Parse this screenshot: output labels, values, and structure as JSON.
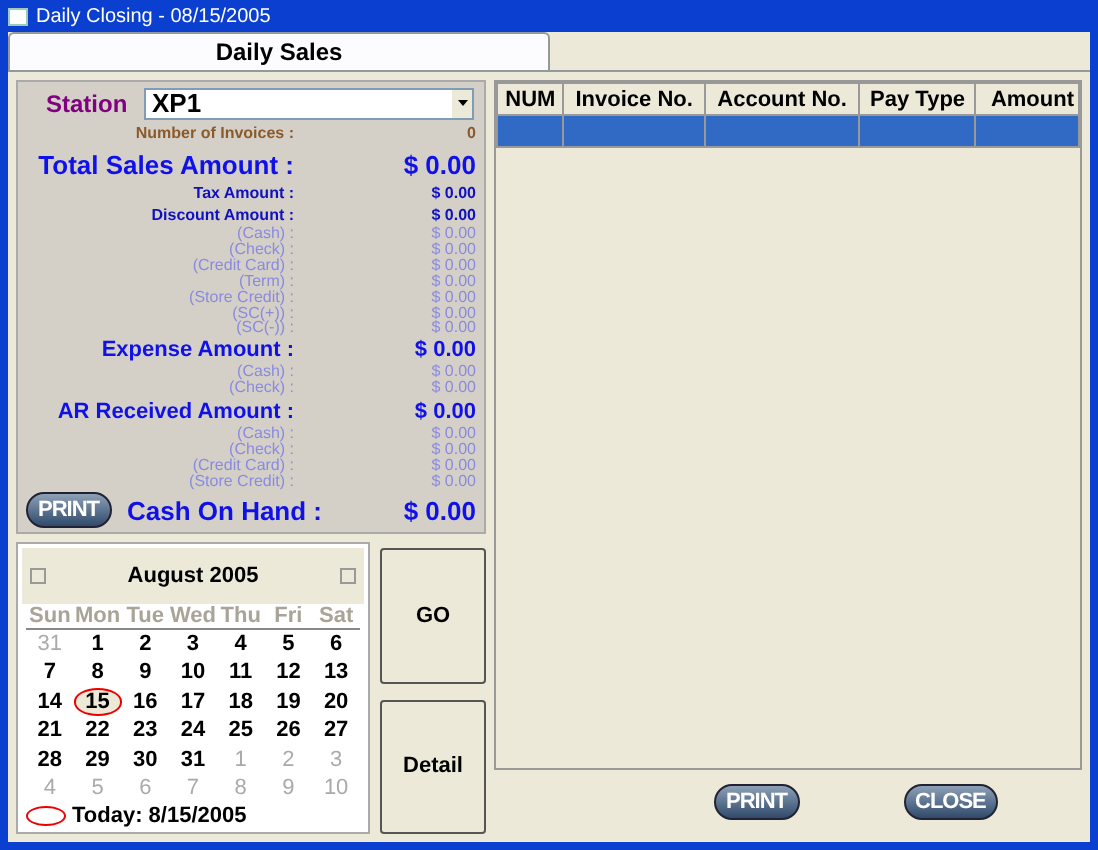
{
  "window": {
    "title": "Daily Closing - 08/15/2005"
  },
  "tabs": [
    {
      "label": "Daily Sales",
      "selected": true
    }
  ],
  "station": {
    "label": "Station",
    "value": "XP1"
  },
  "summary": [
    {
      "kind": "count",
      "label": "Number of Invoices :",
      "value": "0"
    },
    {
      "kind": "major",
      "label": "Total Sales Amount :",
      "value": "$ 0.00"
    },
    {
      "kind": "medium",
      "label": "Tax Amount :",
      "value": "$ 0.00"
    },
    {
      "kind": "medium",
      "label": "Discount Amount :",
      "value": "$ 0.00"
    },
    {
      "kind": "minor",
      "label": "(Cash) :",
      "value": "$ 0.00"
    },
    {
      "kind": "minor",
      "label": "(Check) :",
      "value": "$ 0.00"
    },
    {
      "kind": "minor",
      "label": "(Credit Card) :",
      "value": "$ 0.00"
    },
    {
      "kind": "minor",
      "label": "(Term) :",
      "value": "$ 0.00"
    },
    {
      "kind": "minor",
      "label": "(Store Credit) :",
      "value": "$ 0.00"
    },
    {
      "kind": "tight",
      "label": "(SC(+)) :",
      "value": "$ 0.00"
    },
    {
      "kind": "tight",
      "label": "(SC(-)) :",
      "value": "$ 0.00"
    },
    {
      "kind": "section",
      "label": "Expense Amount :",
      "value": "$ 0.00"
    },
    {
      "kind": "minor",
      "label": "(Cash) :",
      "value": "$ 0.00"
    },
    {
      "kind": "minor",
      "label": "(Check) :",
      "value": "$ 0.00"
    },
    {
      "kind": "section",
      "label": "AR Received Amount :",
      "value": "$ 0.00"
    },
    {
      "kind": "minor",
      "label": "(Cash) :",
      "value": "$ 0.00"
    },
    {
      "kind": "minor",
      "label": "(Check) :",
      "value": "$ 0.00"
    },
    {
      "kind": "minor",
      "label": "(Credit Card) :",
      "value": "$ 0.00"
    },
    {
      "kind": "minor",
      "label": "(Store Credit) :",
      "value": "$ 0.00"
    }
  ],
  "print_button": "PRINT",
  "cash_on_hand": {
    "label": "Cash On Hand :",
    "value": "$ 0.00"
  },
  "calendar": {
    "month": "August 2005",
    "weekdays": [
      "Sun",
      "Mon",
      "Tue",
      "Wed",
      "Thu",
      "Fri",
      "Sat"
    ],
    "days": [
      {
        "day": "31",
        "muted": true,
        "selected": false
      },
      {
        "day": "1",
        "muted": false,
        "selected": false
      },
      {
        "day": "2",
        "muted": false,
        "selected": false
      },
      {
        "day": "3",
        "muted": false,
        "selected": false
      },
      {
        "day": "4",
        "muted": false,
        "selected": false
      },
      {
        "day": "5",
        "muted": false,
        "selected": false
      },
      {
        "day": "6",
        "muted": false,
        "selected": false
      },
      {
        "day": "7",
        "muted": false,
        "selected": false
      },
      {
        "day": "8",
        "muted": false,
        "selected": false
      },
      {
        "day": "9",
        "muted": false,
        "selected": false
      },
      {
        "day": "10",
        "muted": false,
        "selected": false
      },
      {
        "day": "11",
        "muted": false,
        "selected": false
      },
      {
        "day": "12",
        "muted": false,
        "selected": false
      },
      {
        "day": "13",
        "muted": false,
        "selected": false
      },
      {
        "day": "14",
        "muted": false,
        "selected": false
      },
      {
        "day": "15",
        "muted": false,
        "selected": true
      },
      {
        "day": "16",
        "muted": false,
        "selected": false
      },
      {
        "day": "17",
        "muted": false,
        "selected": false
      },
      {
        "day": "18",
        "muted": false,
        "selected": false
      },
      {
        "day": "19",
        "muted": false,
        "selected": false
      },
      {
        "day": "20",
        "muted": false,
        "selected": false
      },
      {
        "day": "21",
        "muted": false,
        "selected": false
      },
      {
        "day": "22",
        "muted": false,
        "selected": false
      },
      {
        "day": "23",
        "muted": false,
        "selected": false
      },
      {
        "day": "24",
        "muted": false,
        "selected": false
      },
      {
        "day": "25",
        "muted": false,
        "selected": false
      },
      {
        "day": "26",
        "muted": false,
        "selected": false
      },
      {
        "day": "27",
        "muted": false,
        "selected": false
      },
      {
        "day": "28",
        "muted": false,
        "selected": false
      },
      {
        "day": "29",
        "muted": false,
        "selected": false
      },
      {
        "day": "30",
        "muted": false,
        "selected": false
      },
      {
        "day": "31",
        "muted": false,
        "selected": false
      },
      {
        "day": "1",
        "muted": true,
        "selected": false
      },
      {
        "day": "2",
        "muted": true,
        "selected": false
      },
      {
        "day": "3",
        "muted": true,
        "selected": false
      },
      {
        "day": "4",
        "muted": true,
        "selected": false
      },
      {
        "day": "5",
        "muted": true,
        "selected": false
      },
      {
        "day": "6",
        "muted": true,
        "selected": false
      },
      {
        "day": "7",
        "muted": true,
        "selected": false
      },
      {
        "day": "8",
        "muted": true,
        "selected": false
      },
      {
        "day": "9",
        "muted": true,
        "selected": false
      },
      {
        "day": "10",
        "muted": true,
        "selected": false
      }
    ],
    "today": "Today: 8/15/2005"
  },
  "go_button": "GO",
  "detail_button": "Detail",
  "table": {
    "columns": [
      "NUM",
      "Invoice No.",
      "Account No.",
      "Pay Type",
      "Amount"
    ],
    "rows": [
      {
        "cells": [
          "",
          "",
          "",
          "",
          ""
        ],
        "selected": true
      }
    ]
  },
  "footer_buttons": [
    "PRINT",
    "CLOSE"
  ]
}
